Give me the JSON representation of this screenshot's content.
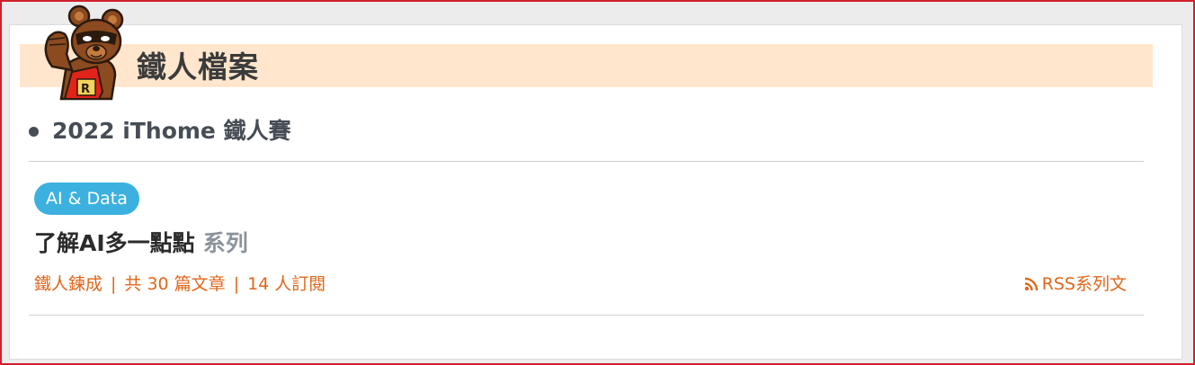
{
  "header": {
    "title": "鐵人檔案",
    "mascot_icon": "bear-mascot-icon",
    "banner_color": "#ffe6cc"
  },
  "event": {
    "title": "2022 iThome 鐵人賽"
  },
  "series": {
    "tag": "AI & Data",
    "tag_color": "#3cb1df",
    "title": "了解AI多一點點",
    "suffix": "系列",
    "meta": {
      "status": "鐵人鍊成",
      "separator": "|",
      "articles": "共 30 篇文章",
      "subscribers": "14 人訂閱"
    },
    "rss_label": "RSS系列文",
    "rss_icon": "rss-icon",
    "accent_color": "#e0661a"
  }
}
